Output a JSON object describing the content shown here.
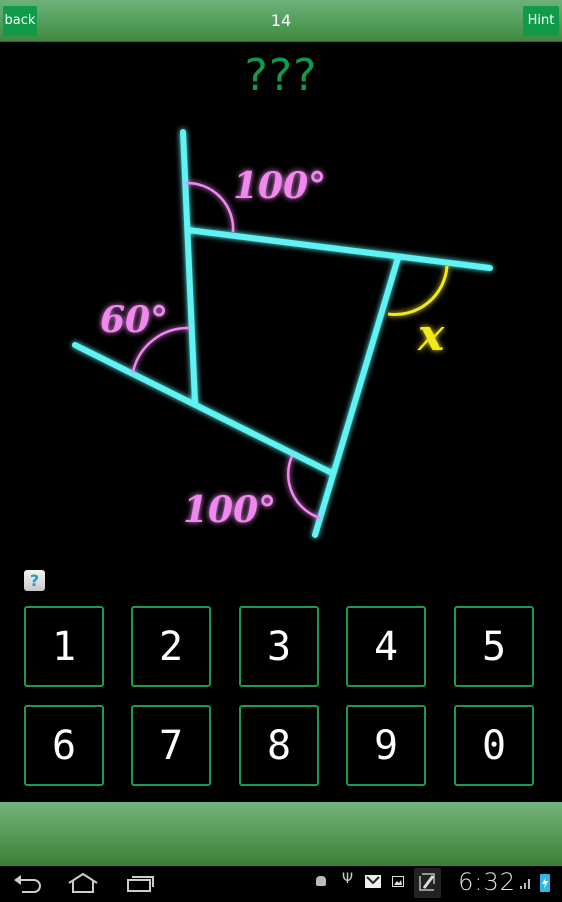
{
  "header": {
    "back_label": "back",
    "level_number": "14",
    "hint_label": "Hint"
  },
  "answer_display": "???",
  "figure": {
    "angle_labels": [
      "100°",
      "60°",
      "100°"
    ],
    "unknown_label": "x",
    "colors": {
      "lines": "#5ef3f3",
      "known_angles": "#f088f0",
      "unknown_angle": "#f2e81a"
    }
  },
  "help_icon": "question-mark",
  "keypad": {
    "keys": [
      "1",
      "2",
      "3",
      "4",
      "5",
      "6",
      "7",
      "8",
      "9",
      "0"
    ]
  },
  "system_bar": {
    "time": "6:32",
    "nav": [
      "back",
      "home",
      "recent-apps"
    ],
    "status_icons": [
      "android-debug",
      "usb",
      "gmail",
      "gallery",
      "screenshot",
      "signal",
      "battery-charging"
    ]
  },
  "colors": {
    "accent": "#109a4a",
    "header_gradient_top": "#6db27a",
    "header_gradient_bottom": "#3f8a3f"
  }
}
